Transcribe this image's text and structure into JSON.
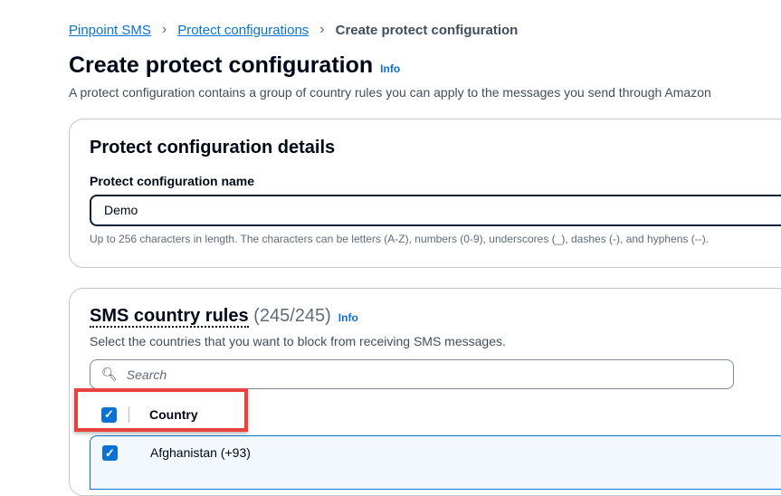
{
  "breadcrumb": [
    "Pinpoint SMS",
    "Protect configurations",
    "Create protect configuration"
  ],
  "page_title": "Create protect configuration",
  "info_label": "Info",
  "description": "A protect configuration contains a group of country rules you can apply to the messages you send through Amazon",
  "details": {
    "title": "Protect configuration details",
    "name_label": "Protect configuration name",
    "name_value": "Demo",
    "hint": "Up to 256 characters in length. The characters can be letters (A-Z), numbers (0-9), underscores (_), dashes (-), and hyphens (--)."
  },
  "rules": {
    "title": "SMS country rules",
    "count": "(245/245)",
    "description": "Select the countries that you want to block from receiving SMS messages.",
    "search_placeholder": "Search",
    "column_header": "Country",
    "rows": [
      {
        "country": "Afghanistan (+93)",
        "checked": true
      }
    ]
  }
}
